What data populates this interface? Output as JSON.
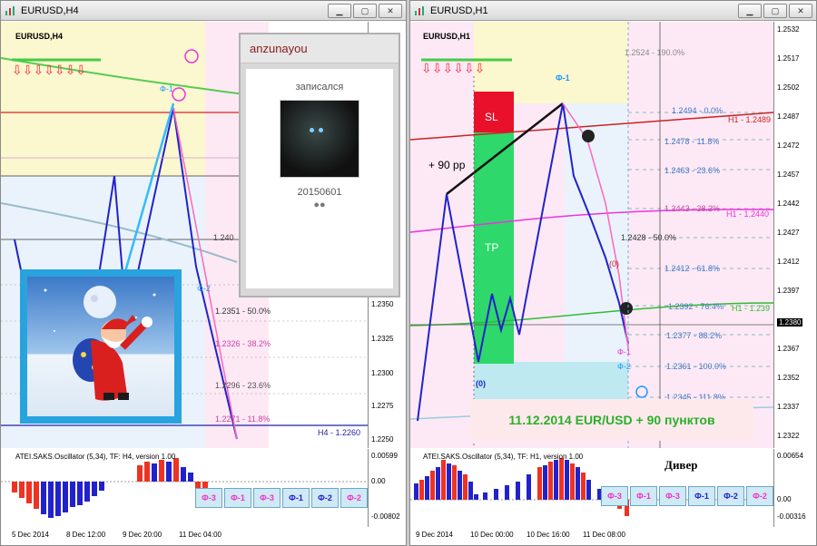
{
  "left_window": {
    "title": "EURUSD,H4",
    "chart_symbol": "EURUSD,H4",
    "price_labels": [
      "1.2350",
      "1.2325",
      "1.2300",
      "1.2275",
      "1.2250"
    ],
    "current_price_tag": "H4 - 1.2260",
    "fib_labels": [
      {
        "text": "1.2351 - 50.0%"
      },
      {
        "text": "1.2326 - 38.2%"
      },
      {
        "text": "1.2296 - 23.6%"
      },
      {
        "text": "1.2271 - 11.8%"
      },
      {
        "text": "1.240"
      }
    ],
    "wave_labels": [
      "Ф-1",
      "Ф-2"
    ],
    "osc_title": "ATEI.SAKS.Oscillator (5,34), TF: H4, version 1.00",
    "osc_values": [
      "0.00599",
      "0.00",
      "-0.00802"
    ],
    "time_labels": [
      "5 Dec 2014",
      "8 Dec 12:00",
      "9 Dec 20:00",
      "11 Dec 04:00"
    ],
    "buttons": [
      "Ф-3",
      "Ф-1",
      "Ф-3",
      "Ф-1",
      "Ф-2",
      "Ф-2"
    ]
  },
  "popup": {
    "username": "anzunayou",
    "caption": "записался",
    "date": "20150601",
    "dots": "●●"
  },
  "right_window": {
    "title": "EURUSD,H1",
    "chart_symbol": "EURUSD,H1",
    "price_labels": [
      "1.2532",
      "1.2517",
      "1.2502",
      "1.2487",
      "1.2472",
      "1.2457",
      "1.2442",
      "1.2427",
      "1.2412",
      "1.2397",
      "1.2380",
      "1.2367",
      "1.2352",
      "1.2337",
      "1.2322"
    ],
    "fib_labels": [
      {
        "text": "1.2524 - 190.0%"
      },
      {
        "text": "1.2494 - 0.0%"
      },
      {
        "text": "1.2478 - 11.8%"
      },
      {
        "text": "1.2463 - 23.6%"
      },
      {
        "text": "1.2443 - 38.2%"
      },
      {
        "text": "1.2428 - 50.0%"
      },
      {
        "text": "1.2412 - 61.8%"
      },
      {
        "text": "1.2392 - 76.4%"
      },
      {
        "text": "1.2377 - 88.2%"
      },
      {
        "text": "1.2361 - 100.0%"
      },
      {
        "text": "1.2345 - 111.8%"
      }
    ],
    "h1_tags": [
      "H1 - 1.2489",
      "H1 - 1.2440",
      "H1 - 1.239"
    ],
    "sl_label": "SL",
    "tp_label": "TP",
    "pp_label": "+ 90 pp",
    "wave_labels": [
      "Ф-1",
      "(0)",
      "(0)",
      "Ф-1",
      "Ф-2"
    ],
    "osc_title": "ATEI.SAKS.Oscillator (5,34), TF: H1, version 1.00",
    "osc_values": [
      "0.00654",
      "0.00",
      "-0.00316"
    ],
    "diver_label": "Дивер",
    "time_labels": [
      "9 Dec 2014",
      "10 Dec 00:00",
      "10 Dec 16:00",
      "11 Dec 08:00"
    ],
    "buttons": [
      "Ф-3",
      "Ф-1",
      "Ф-3",
      "Ф-1",
      "Ф-2",
      "Ф-2"
    ],
    "banner": "11.12.2014  EUR/USD  + 90 пунктов"
  },
  "colors": {
    "button_bg": "#cfe9f5",
    "banner_text": "#2bb02b",
    "sl": "#e8102a",
    "tp": "#2ed86a"
  }
}
